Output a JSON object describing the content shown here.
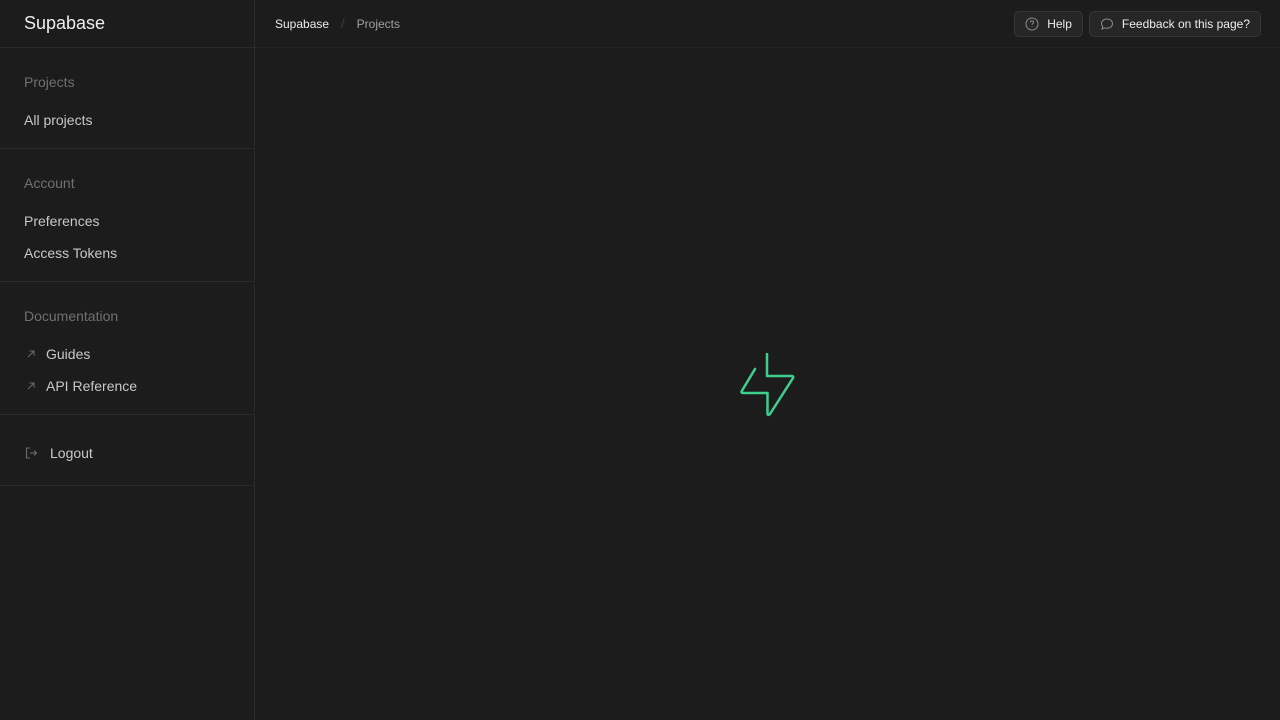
{
  "app": {
    "brand": "Supabase"
  },
  "sidebar": {
    "sections": [
      {
        "title": "Projects",
        "items": [
          {
            "label": "All projects"
          }
        ]
      },
      {
        "title": "Account",
        "items": [
          {
            "label": "Preferences"
          },
          {
            "label": "Access Tokens"
          }
        ]
      },
      {
        "title": "Documentation",
        "items": [
          {
            "label": "Guides",
            "icon": "external-link-arrow-icon"
          },
          {
            "label": "API Reference",
            "icon": "external-link-arrow-icon"
          }
        ]
      }
    ],
    "logout": {
      "label": "Logout",
      "icon": "logout-icon"
    }
  },
  "topbar": {
    "breadcrumb": {
      "root": "Supabase",
      "separator": "/",
      "current": "Projects"
    },
    "help_label": "Help",
    "help_icon": "help-circle-icon",
    "feedback_label": "Feedback on this page?",
    "feedback_icon": "message-bubble-icon"
  },
  "loader": {
    "icon": "supabase-logo-icon",
    "color": "#3ecf8e"
  },
  "colors": {
    "background": "#1c1c1c",
    "border": "#2a2a2a",
    "accent": "#3ecf8e"
  }
}
